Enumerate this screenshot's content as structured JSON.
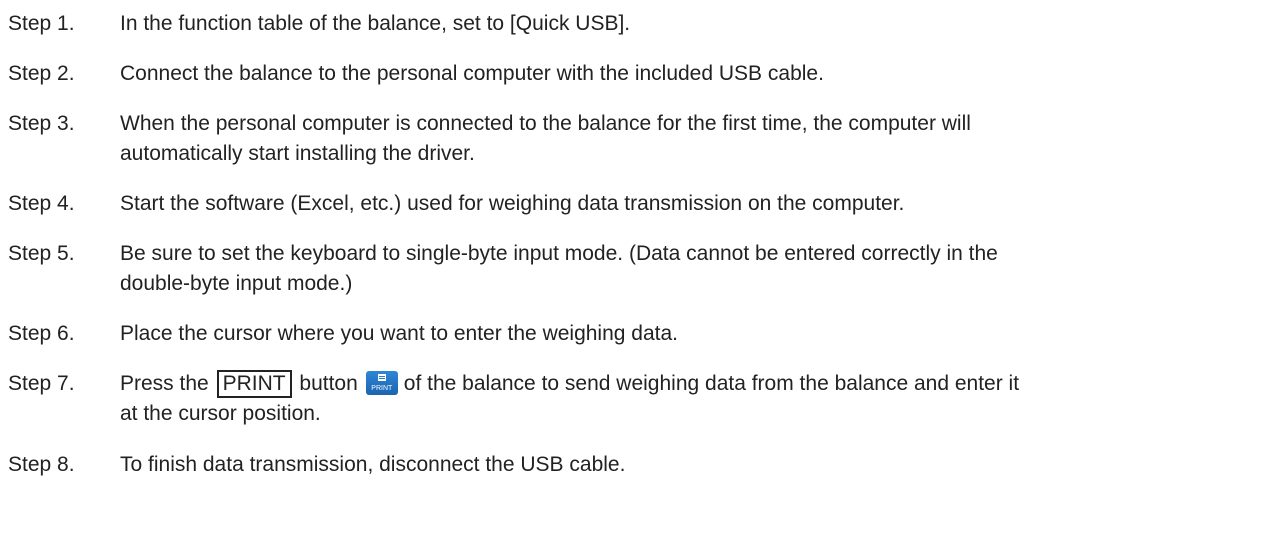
{
  "steps": [
    {
      "num": "Step 1.",
      "lines": [
        "In the function table of the balance, set to [Quick USB]."
      ]
    },
    {
      "num": "Step 2.",
      "lines": [
        "Connect the balance to the personal computer with the included USB cable."
      ]
    },
    {
      "num": "Step 3.",
      "lines": [
        "When the personal computer is connected to the balance for the first time, the computer will",
        "automatically start installing the driver."
      ]
    },
    {
      "num": "Step 4.",
      "lines": [
        "Start the software (Excel, etc.) used for weighing data transmission on the computer."
      ]
    },
    {
      "num": "Step 5.",
      "lines": [
        "Be sure to set the keyboard to single-byte input mode. (Data cannot be entered correctly in the",
        "double-byte input mode.)"
      ]
    },
    {
      "num": "Step 6.",
      "lines": [
        "Place the cursor where you want to enter the weighing data."
      ]
    },
    {
      "num": "Step 7.",
      "pre": "Press the",
      "key": "PRINT",
      "mid": "button",
      "icon_label": "PRINT",
      "icon": "print-key-icon",
      "post": "of the balance to send weighing data from the balance and enter it",
      "line2": "at the cursor position."
    },
    {
      "num": "Step 8.",
      "lines": [
        "To finish data transmission, disconnect the USB cable."
      ]
    }
  ],
  "colors": {
    "text": "#222222",
    "print_key": "#1f6fc0"
  }
}
